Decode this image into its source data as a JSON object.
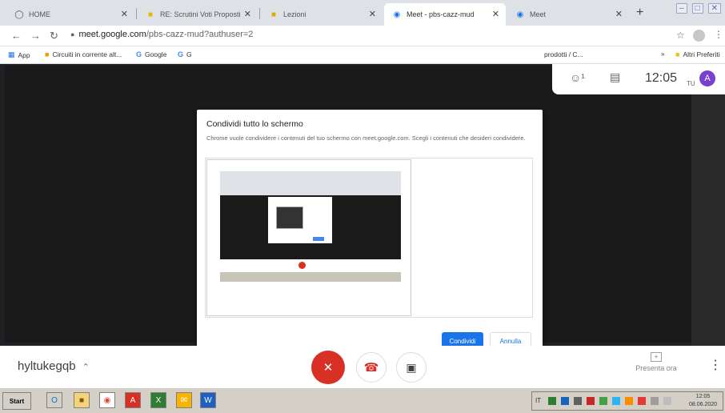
{
  "browser": {
    "tabs": [
      {
        "title": "HOME",
        "icon": "globe-icon",
        "active": false
      },
      {
        "title": "RE: Scrutini Voti Proposti",
        "icon": "mail-icon",
        "active": false
      },
      {
        "title": "Lezioni",
        "icon": "lessons-icon",
        "active": false
      },
      {
        "title": "Meet - pbs-cazz-mud",
        "icon": "meet-icon",
        "active": true
      },
      {
        "title": "Meet",
        "icon": "meet-icon",
        "active": false
      }
    ],
    "url_host": "meet.google.com",
    "url_path": "/pbs-cazz-mud?authuser=2",
    "bookmarks": [
      {
        "label": "App",
        "icon": "apps-grid-icon"
      },
      {
        "label": "Circuiti in corrente alt...",
        "icon": "bookmark-icon"
      },
      {
        "label": "Google",
        "icon": "google-icon"
      },
      {
        "label": "G",
        "icon": "google-icon"
      },
      {
        "label": "prodotti / C...",
        "icon": "bookmark-icon"
      },
      {
        "label": "Altri Preferiti",
        "icon": "folder-icon"
      }
    ]
  },
  "meet": {
    "time": "12:05",
    "self_label": "TU",
    "avatar_letter": "A",
    "meeting_code": "hyltukegqb",
    "present_label": "Presenta ora"
  },
  "dialog": {
    "title": "Condividi tutto lo schermo",
    "description": "Chrome vuole condividere i contenuti del tuo schermo con meet.google.com. Scegli i contenuti che desideri condividere.",
    "share_label": "Condividi",
    "cancel_label": "Annulla"
  },
  "taskbar": {
    "start_label": "Start",
    "lang": "IT",
    "clock_time": "12:05",
    "clock_date": "08.06.2020"
  },
  "colors": {
    "meet_red": "#d93025",
    "google_blue": "#1a73e8",
    "avatar_purple": "#7b3fd0"
  }
}
